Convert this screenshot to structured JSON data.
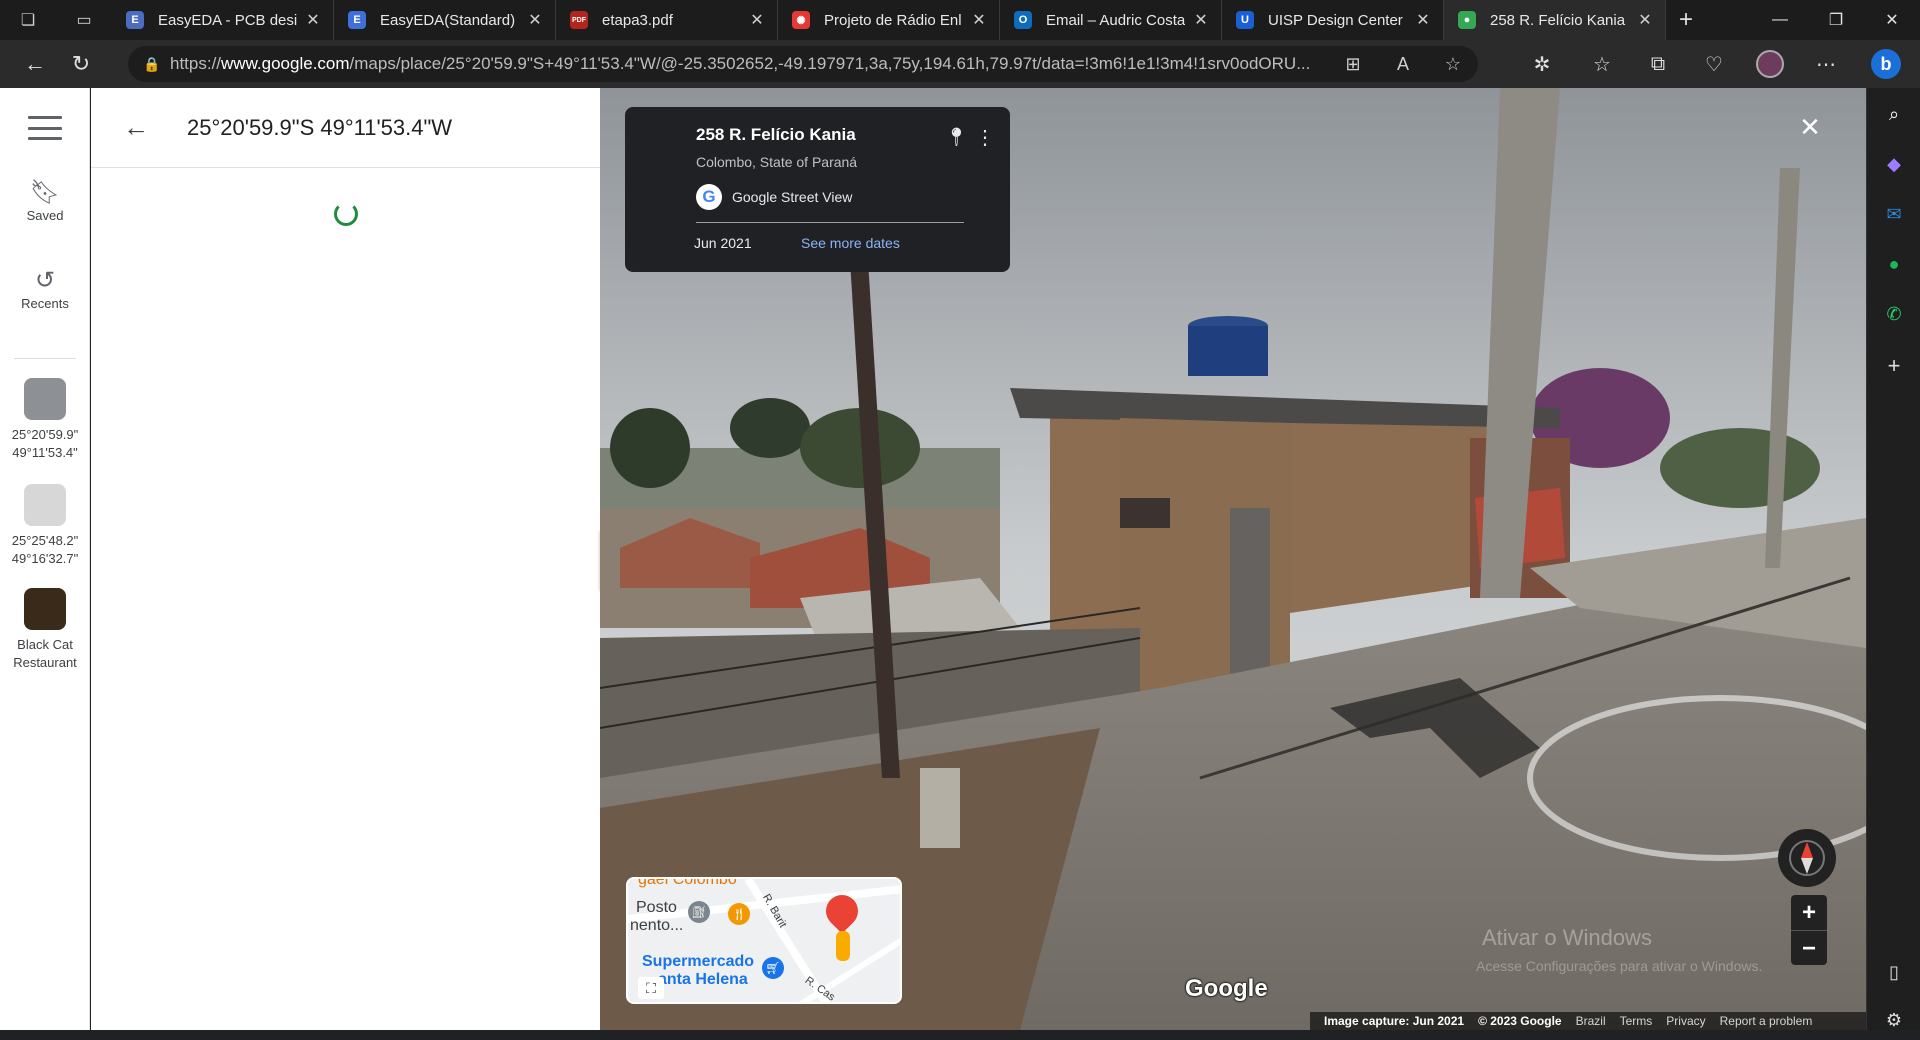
{
  "browser": {
    "tabs": [
      {
        "title": "EasyEDA - PCB desig",
        "color": "#4b6cc1",
        "icon": "E",
        "active": false
      },
      {
        "title": "EasyEDA(Standard) -",
        "color": "#3f6fd8",
        "icon": "E",
        "active": false
      },
      {
        "title": "etapa3.pdf",
        "color": "#b3261e",
        "icon": "PDF",
        "active": false
      },
      {
        "title": "Projeto de Rádio Enl",
        "color": "#e53935",
        "icon": "✺",
        "active": false
      },
      {
        "title": "Email – Audric Costa",
        "color": "#0f6cbd",
        "icon": "O",
        "active": false
      },
      {
        "title": "UISP Design Center",
        "color": "#1a5fd6",
        "icon": "U",
        "active": false
      },
      {
        "title": "258 R. Felício Kania -",
        "color": "#34a853",
        "icon": "●",
        "active": true
      }
    ],
    "url_prefix": "https://",
    "url_host": "www.google.com",
    "url_path": "/maps/place/25°20'59.9\"S+49°11'53.4\"W/@-25.3502652,-49.197971,3a,75y,194.61h,79.97t/data=!3m6!1e1!3m4!1srv0odORU..."
  },
  "rail": {
    "saved_label": "Saved",
    "recents_label": "Recents",
    "recents": [
      {
        "line1": "25°20'59.9\"",
        "line2": "49°11'53.4\"",
        "thumb": "#8d9196"
      },
      {
        "line1": "25°25'48.2\"",
        "line2": "49°16'32.7\"",
        "thumb": "#d7d7d7"
      },
      {
        "line1": "Black Cat",
        "line2": "Restaurant",
        "thumb": "#3a2a1a"
      }
    ]
  },
  "panel": {
    "title": "25°20'59.9\"S 49°11'53.4\"W"
  },
  "streetview": {
    "address": "258 R. Felício Kania",
    "locality": "Colombo, State of Paraná",
    "source": "Google Street View",
    "date": "Jun 2021",
    "more_dates": "See more dates"
  },
  "minimap": {
    "poi_top": "gael Colombo",
    "poi_posto_1": "Posto",
    "poi_posto_2": "nento...",
    "street_1": "R. Barit",
    "poi_super_1": "Supermercado",
    "poi_super_2": "anta Helena",
    "street_2": "R. Cas"
  },
  "footer": {
    "logo": "Google",
    "capture": "Image capture: Jun 2021",
    "copyright": "© 2023 Google",
    "country": "Brazil",
    "terms": "Terms",
    "privacy": "Privacy",
    "report": "Report a problem"
  },
  "watermark": {
    "line1": "Ativar o Windows",
    "line2": "Acesse Configurações para ativar o Windows."
  }
}
